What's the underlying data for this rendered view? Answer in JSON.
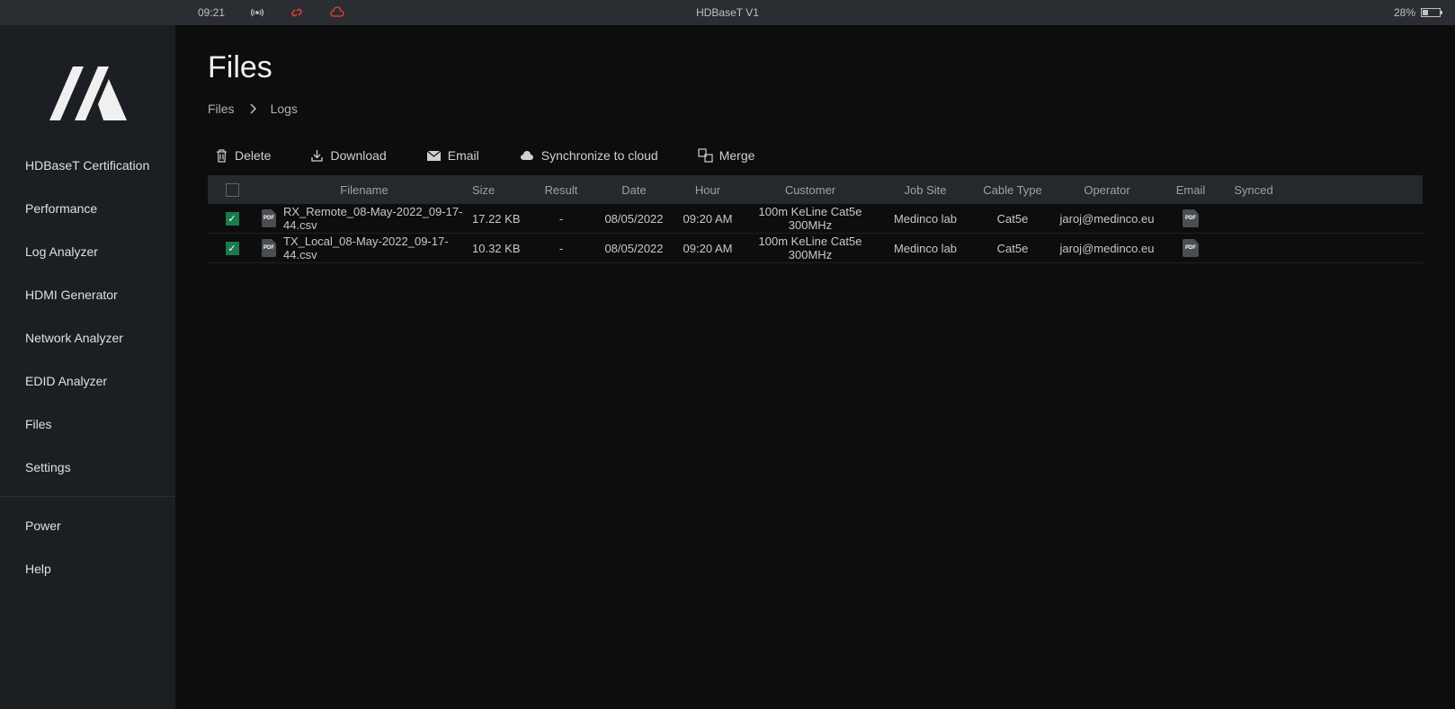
{
  "statusbar": {
    "time": "09:21",
    "center": "HDBaseT V1",
    "battery_pct": "28%"
  },
  "sidebar": {
    "items": [
      {
        "label": "HDBaseT Certification"
      },
      {
        "label": "Performance"
      },
      {
        "label": "Log Analyzer"
      },
      {
        "label": "HDMI Generator"
      },
      {
        "label": "Network Analyzer"
      },
      {
        "label": "EDID Analyzer"
      },
      {
        "label": "Files"
      },
      {
        "label": "Settings"
      }
    ],
    "secondary": [
      {
        "label": "Power"
      },
      {
        "label": "Help"
      }
    ]
  },
  "page": {
    "title": "Files",
    "breadcrumb": [
      "Files",
      "Logs"
    ]
  },
  "toolbar": {
    "delete": "Delete",
    "download": "Download",
    "email": "Email",
    "sync": "Synchronize to cloud",
    "merge": "Merge"
  },
  "table": {
    "headers": {
      "filename": "Filename",
      "size": "Size",
      "result": "Result",
      "date": "Date",
      "hour": "Hour",
      "customer": "Customer",
      "jobsite": "Job Site",
      "cabletype": "Cable Type",
      "operator": "Operator",
      "email": "Email",
      "synced": "Synced"
    },
    "rows": [
      {
        "checked": true,
        "filename": "RX_Remote_08-May-2022_09-17-44.csv",
        "size": "17.22 KB",
        "result": "-",
        "date": "08/05/2022",
        "hour": "09:20 AM",
        "customer": "100m KeLine Cat5e 300MHz",
        "jobsite": "Medinco lab",
        "cabletype": "Cat5e",
        "operator": "jaroj@medinco.eu"
      },
      {
        "checked": true,
        "filename": "TX_Local_08-May-2022_09-17-44.csv",
        "size": "10.32 KB",
        "result": "-",
        "date": "08/05/2022",
        "hour": "09:20 AM",
        "customer": "100m KeLine Cat5e 300MHz",
        "jobsite": "Medinco lab",
        "cabletype": "Cat5e",
        "operator": "jaroj@medinco.eu"
      }
    ]
  }
}
